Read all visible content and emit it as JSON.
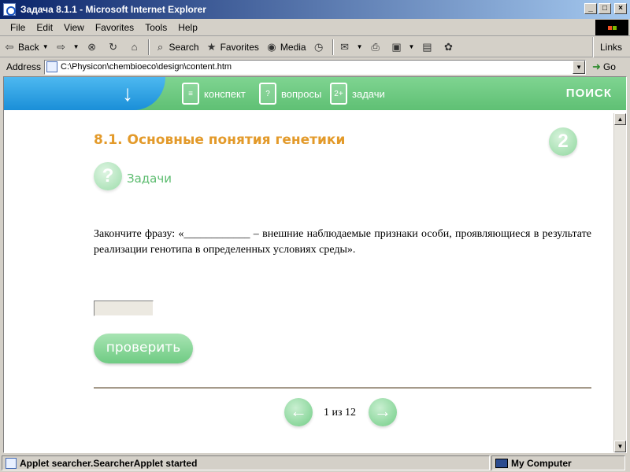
{
  "window": {
    "title": "Задача 8.1.1 - Microsoft Internet Explorer",
    "controls": {
      "minimize": "_",
      "maximize": "□",
      "close": "×"
    }
  },
  "menu": [
    "File",
    "Edit",
    "View",
    "Favorites",
    "Tools",
    "Help"
  ],
  "toolbar": {
    "back": "Back",
    "search": "Search",
    "favorites": "Favorites",
    "media": "Media",
    "links": "Links"
  },
  "address": {
    "label": "Address",
    "url": "C:\\Physicon\\chembioeco\\design\\content.htm",
    "go": "Go"
  },
  "site": {
    "nav": [
      {
        "label": "конспект",
        "icon": "notebook-icon"
      },
      {
        "label": "вопросы",
        "icon": "questions-icon"
      },
      {
        "label": "задачи",
        "icon": "tasks-icon"
      }
    ],
    "search": "ПОИСК"
  },
  "content": {
    "title": "8.1. Основные понятия генетики",
    "level": "2",
    "task_icon": "?",
    "section": "Задачи",
    "question": "Закончите фразу: «____________ – внешние наблюдаемые признаки особи, проявляющиеся в результате реализации генотипа в определенных условиях среды».",
    "answer_value": "",
    "check_button": "проверить",
    "pager": "1 из 12"
  },
  "status": {
    "text": "Applet searcher.SearcherApplet started",
    "zone": "My Computer"
  },
  "colors": {
    "title_orange": "#e39a2a",
    "header_green": "#5fc074",
    "header_blue": "#1a8fd8"
  }
}
